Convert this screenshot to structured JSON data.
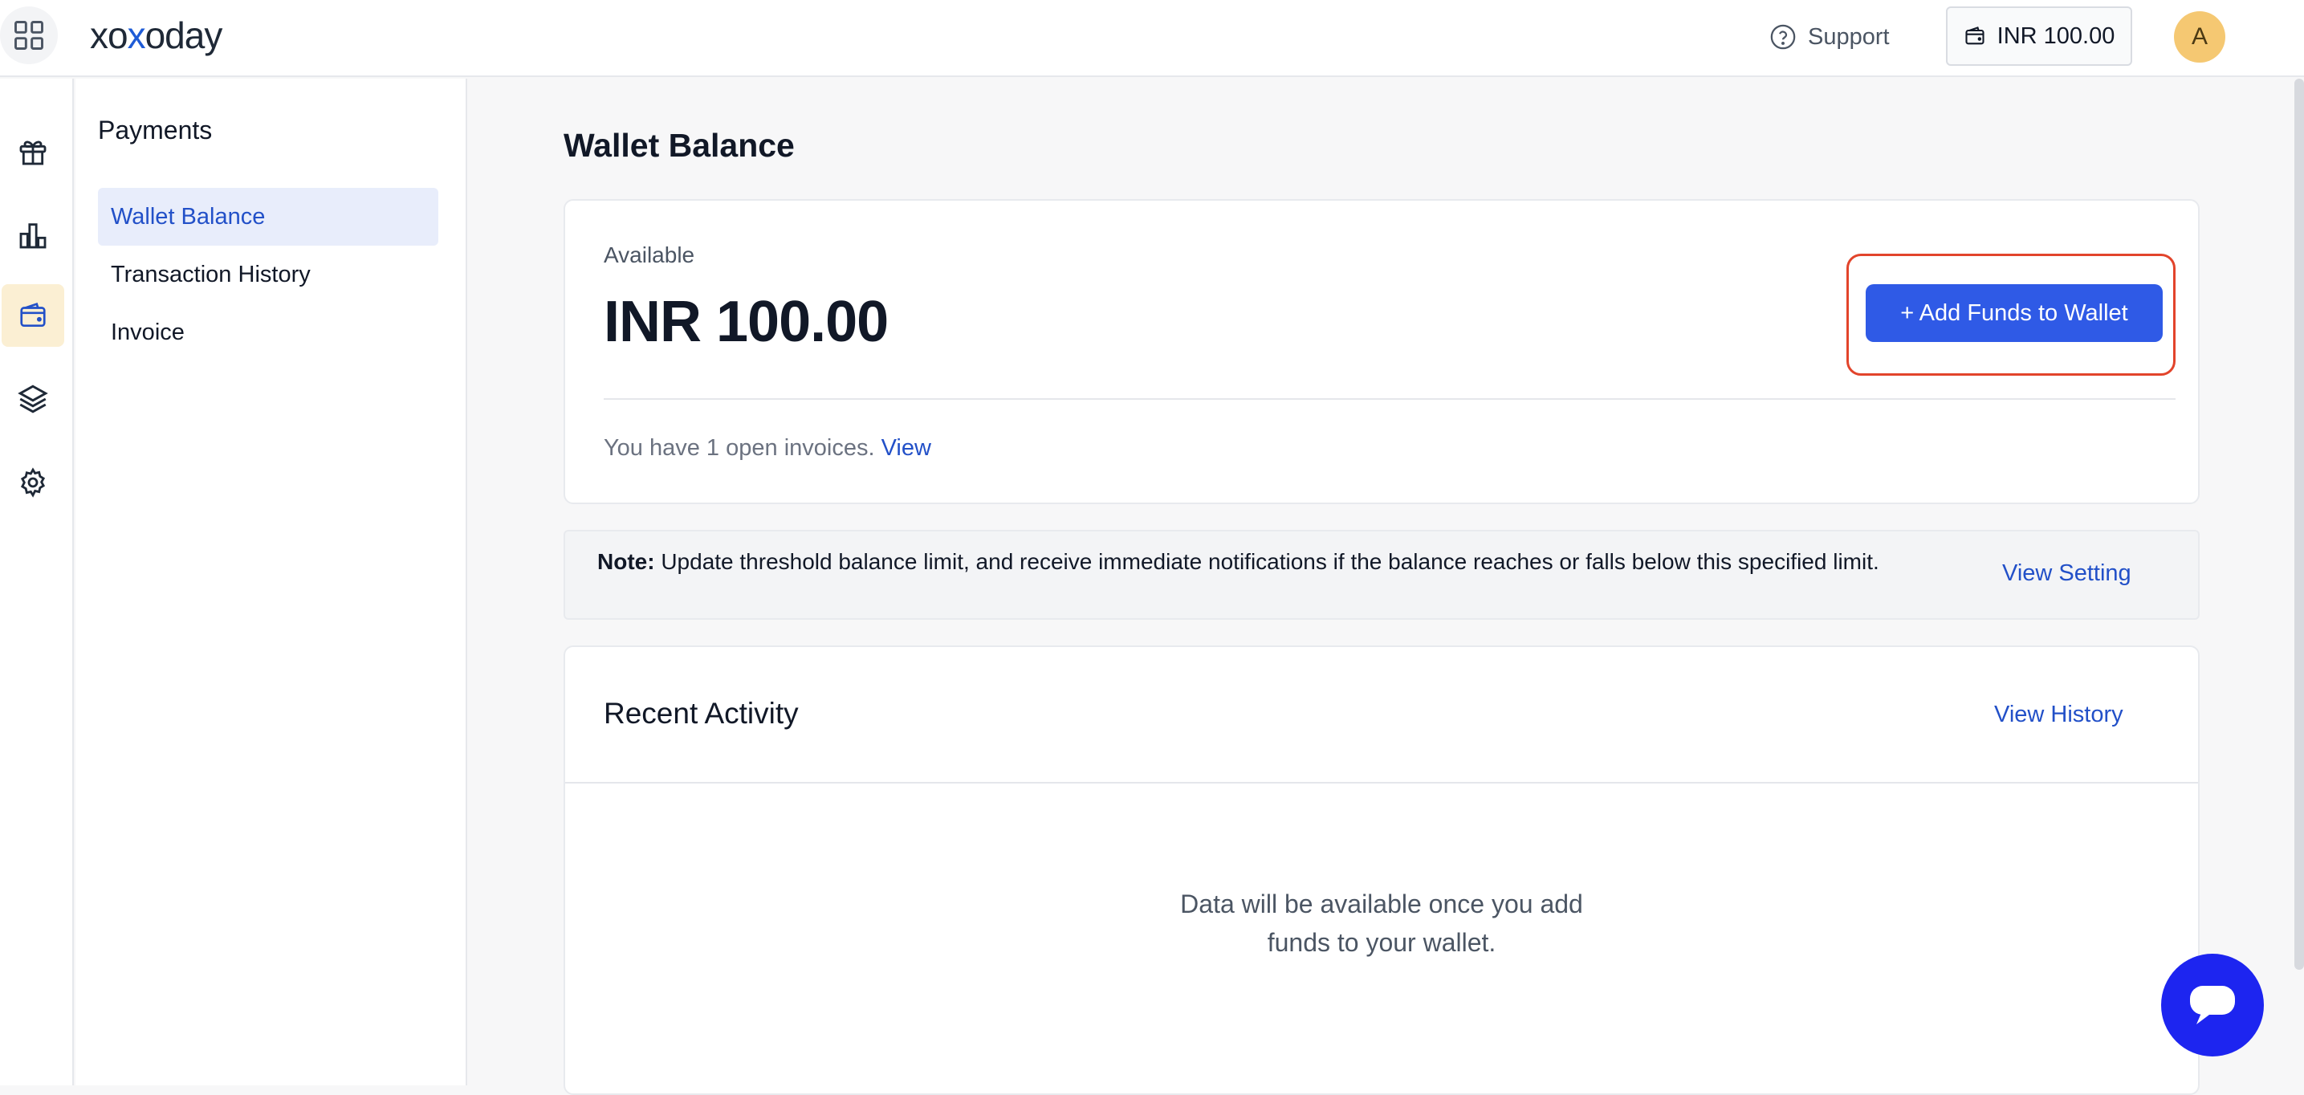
{
  "header": {
    "logo": {
      "prefix": "xo",
      "x": "x",
      "suffix": "oday"
    },
    "support_label": "Support",
    "wallet_chip": "INR 100.00",
    "avatar_initial": "A"
  },
  "rail": {
    "items": [
      {
        "icon": "gift-icon"
      },
      {
        "icon": "bar-chart-icon"
      },
      {
        "icon": "wallet-icon",
        "active": true
      },
      {
        "icon": "layers-icon"
      },
      {
        "icon": "gear-icon"
      }
    ]
  },
  "subnav": {
    "title": "Payments",
    "items": [
      {
        "label": "Wallet Balance",
        "active": true
      },
      {
        "label": "Transaction History"
      },
      {
        "label": "Invoice"
      }
    ]
  },
  "main": {
    "title": "Wallet Balance",
    "balance": {
      "label": "Available",
      "amount": "INR 100.00",
      "add_funds": "+ Add Funds to Wallet",
      "invoices_text": "You have 1 open invoices.",
      "invoices_link": "View"
    },
    "note": {
      "bold": "Note:",
      "text": " Update threshold balance limit, and receive immediate notifications if the balance reaches or falls below this specified limit.",
      "link": "View Setting"
    },
    "activity": {
      "title": "Recent Activity",
      "link": "View History",
      "empty_line1": "Data will be available once you add",
      "empty_line2": "funds to your wallet."
    }
  },
  "colors": {
    "accent": "#2f5ae6",
    "link": "#2250c8",
    "highlight_outline": "#e2442b",
    "chat": "#1d25f0",
    "active_rail": "#fbefd3"
  }
}
